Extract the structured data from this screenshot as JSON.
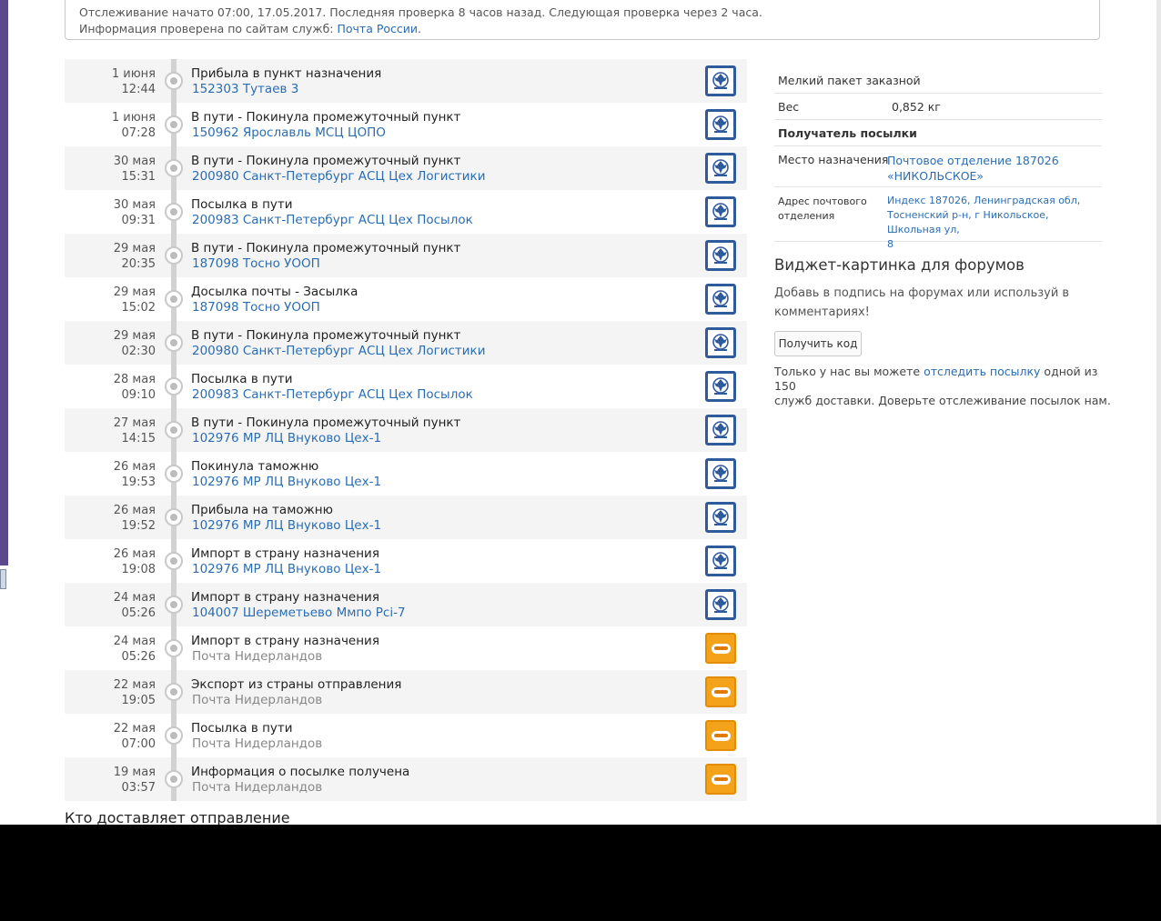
{
  "info": {
    "line1": "Отслеживание начато 07:00, 17.05.2017. Последняя проверка 8 часов назад. Следующая проверка через 2 часа.",
    "line2_prefix": "Информация проверена по сайтам служб:",
    "service_link": "Почта России",
    "line2_suffix": "."
  },
  "events": [
    {
      "date": "1 июня",
      "time": "12:44",
      "title": "Прибыла в пункт назначения",
      "location": "152303 Тутаев 3",
      "carrier_icon": "russian-post-icon"
    },
    {
      "date": "1 июня",
      "time": "07:28",
      "title": "В пути - Покинула промежуточный пункт",
      "location": "150962 Ярославль МСЦ ЦОПО",
      "carrier_icon": "russian-post-icon"
    },
    {
      "date": "30 мая",
      "time": "15:31",
      "title": "В пути - Покинула промежуточный пункт",
      "location": "200980 Санкт-Петербург АСЦ Цех Логистики",
      "carrier_icon": "russian-post-icon"
    },
    {
      "date": "30 мая",
      "time": "09:31",
      "title": "Посылка в пути",
      "location": "200983 Санкт-Петербург АСЦ Цех Посылок",
      "carrier_icon": "russian-post-icon"
    },
    {
      "date": "29 мая",
      "time": "20:35",
      "title": "В пути - Покинула промежуточный пункт",
      "location": "187098 Тосно УООП",
      "carrier_icon": "russian-post-icon"
    },
    {
      "date": "29 мая",
      "time": "15:02",
      "title": "Досылка почты - Засылка",
      "location": "187098 Тосно УООП",
      "carrier_icon": "russian-post-icon"
    },
    {
      "date": "29 мая",
      "time": "02:30",
      "title": "В пути - Покинула промежуточный пункт",
      "location": "200980 Санкт-Петербург АСЦ Цех Логистики",
      "carrier_icon": "russian-post-icon"
    },
    {
      "date": "28 мая",
      "time": "09:10",
      "title": "Посылка в пути",
      "location": "200983 Санкт-Петербург АСЦ Цех Посылок",
      "carrier_icon": "russian-post-icon"
    },
    {
      "date": "27 мая",
      "time": "14:15",
      "title": "В пути - Покинула промежуточный пункт",
      "location": "102976 МР ЛЦ Внуково Цех-1",
      "carrier_icon": "russian-post-icon"
    },
    {
      "date": "26 мая",
      "time": "19:53",
      "title": "Покинула таможню",
      "location": "102976 МР ЛЦ Внуково Цех-1",
      "carrier_icon": "russian-post-icon"
    },
    {
      "date": "26 мая",
      "time": "19:52",
      "title": "Прибыла на таможню",
      "location": "102976 МР ЛЦ Внуково Цех-1",
      "carrier_icon": "russian-post-icon"
    },
    {
      "date": "26 мая",
      "time": "19:08",
      "title": "Импорт в страну назначения",
      "location": "102976 МР ЛЦ Внуково Цех-1",
      "carrier_icon": "russian-post-icon"
    },
    {
      "date": "24 мая",
      "time": "05:26",
      "title": "Импорт в страну назначения",
      "location": "104007 Шереметьево Ммпо Pci-7",
      "carrier_icon": "russian-post-icon"
    },
    {
      "date": "24 мая",
      "time": "05:26",
      "title": "Импорт в страну назначения",
      "location": "Почта Нидерландов",
      "carrier_icon": "postnl-icon"
    },
    {
      "date": "22 мая",
      "time": "19:05",
      "title": "Экспорт из страны отправления",
      "location": "Почта Нидерландов",
      "carrier_icon": "postnl-icon"
    },
    {
      "date": "22 мая",
      "time": "07:00",
      "title": "Посылка в пути",
      "location": "Почта Нидерландов",
      "carrier_icon": "postnl-icon"
    },
    {
      "date": "19 мая",
      "time": "03:57",
      "title": "Информация о посылке получена",
      "location": "Почта Нидерландов",
      "carrier_icon": "postnl-icon"
    }
  ],
  "bottom_heading": "Кто доставляет отправление",
  "details": {
    "package_type": "Мелкий пакет заказной",
    "weight_label": "Вес",
    "weight_value": "0,852 кг",
    "recipient_heading": "Получатель посылки",
    "destination_label": "Место назначения",
    "destination_line1": "Почтовое отделение 187026",
    "destination_line2": "«НИКОЛЬСКОЕ»",
    "address_label_line1": "Адрес почтового",
    "address_label_line2": "отделения",
    "address_line1": "Индекс 187026, Ленинградская обл,",
    "address_line2": "Тосненский р-н, г Никольское, Школьная ул,",
    "address_line3": "8"
  },
  "widget": {
    "heading": "Виджет-картинка для форумов",
    "text_line1": "Добавь в подпись на форумах или используй в",
    "text_line2": "комментариях!",
    "button_label": "Получить код",
    "promo_prefix": "Только у нас вы можете",
    "promo_link": "отследить посылку",
    "promo_suffix": "одной из 150",
    "promo_line2": "служб доставки. Доверьте отслеживание посылок нам."
  },
  "colors": {
    "link": "#2a6db3",
    "russian_post": "#2f5b9c",
    "postnl": "#f4a21a",
    "row_alt": "#f4f4f4"
  }
}
